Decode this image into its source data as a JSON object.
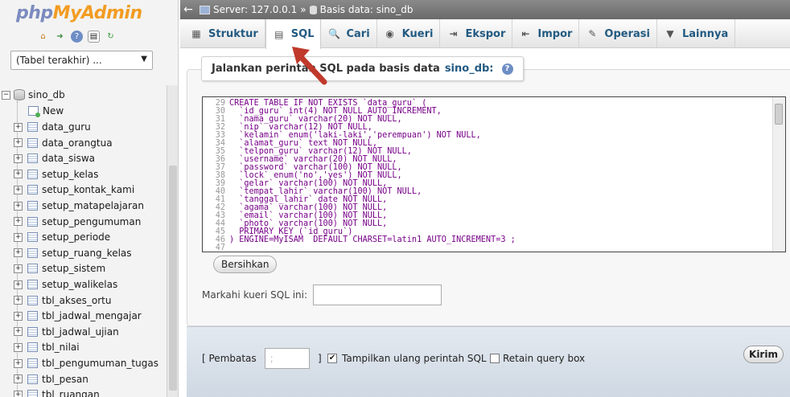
{
  "app": {
    "logo_php": "php",
    "logo_admin": "MyAdmin"
  },
  "sidebar": {
    "recent_tables_select": "(Tabel terakhir) ...",
    "database": "sino_db",
    "new_label": "New",
    "tables": [
      "data_guru",
      "data_orangtua",
      "data_siswa",
      "setup_kelas",
      "setup_kontak_kami",
      "setup_matapelajaran",
      "setup_pengumuman",
      "setup_periode",
      "setup_ruang_kelas",
      "setup_sistem",
      "setup_walikelas",
      "tbl_akses_ortu",
      "tbl_jadwal_mengajar",
      "tbl_jadwal_ujian",
      "tbl_nilai",
      "tbl_pengumuman_tugas",
      "tbl_pesan",
      "tbl_ruangan"
    ]
  },
  "breadcrumb": {
    "server": "Server: 127.0.0.1",
    "separator": "»",
    "database": "Basis data: sino_db"
  },
  "tabs": [
    {
      "label": "Struktur",
      "icon": "structure-icon"
    },
    {
      "label": "SQL",
      "icon": "sql-icon",
      "active": true
    },
    {
      "label": "Cari",
      "icon": "search-icon"
    },
    {
      "label": "Kueri",
      "icon": "query-icon"
    },
    {
      "label": "Ekspor",
      "icon": "export-icon"
    },
    {
      "label": "Impor",
      "icon": "import-icon"
    },
    {
      "label": "Operasi",
      "icon": "wrench-icon"
    },
    {
      "label": "Lainnya",
      "icon": "chevron-down-icon"
    }
  ],
  "sql_panel": {
    "legend_prefix": "Jalankan perintah SQL pada basis data",
    "legend_db": "sino_db:",
    "line_numbers": [
      "29",
      "30",
      "31",
      "32",
      "33",
      "34",
      "35",
      "36",
      "37",
      "38",
      "39",
      "40",
      "41",
      "42",
      "43",
      "44",
      "45",
      "46",
      "47"
    ],
    "code_lines": [
      "CREATE TABLE IF NOT EXISTS `data_guru` (",
      "  `id_guru` int(4) NOT NULL AUTO_INCREMENT,",
      "  `nama_guru` varchar(20) NOT NULL,",
      "  `nip` varchar(12) NOT NULL,",
      "  `kelamin` enum('laki-laki','perempuan') NOT NULL,",
      "  `alamat_guru` text NOT NULL,",
      "  `telpon_guru` varchar(12) NOT NULL,",
      "  `username` varchar(20) NOT NULL,",
      "  `password` varchar(100) NOT NULL,",
      "  `lock` enum('no','yes') NOT NULL,",
      "  `gelar` varchar(100) NOT NULL,",
      "  `tempat_lahir` varchar(100) NOT NULL,",
      "  `tanggal_lahir` date NOT NULL,",
      "  `agama` varchar(100) NOT NULL,",
      "  `email` varchar(100) NOT NULL,",
      "  `photo` varchar(100) NOT NULL,",
      "  PRIMARY KEY (`id_guru`)",
      ") ENGINE=MyISAM  DEFAULT CHARSET=latin1 AUTO_INCREMENT=3 ;",
      ""
    ],
    "clear_button": "Bersihkan",
    "bookmark_label": "Markahi kueri SQL ini:",
    "bookmark_value": ""
  },
  "bottom": {
    "delimiter_label": "[ Pembatas",
    "delimiter_value": ";",
    "bracket_close": "]",
    "show_again_label": "Tampilkan ulang perintah SQL",
    "show_again_checked": true,
    "retain_label": "Retain query box",
    "retain_checked": false,
    "go_button": "Kirim"
  },
  "colors": {
    "tab_text": "#235a81",
    "logo_php": "#7c8bbf",
    "logo_admin": "#f29c22",
    "annotation_arrow": "#c0392b"
  }
}
